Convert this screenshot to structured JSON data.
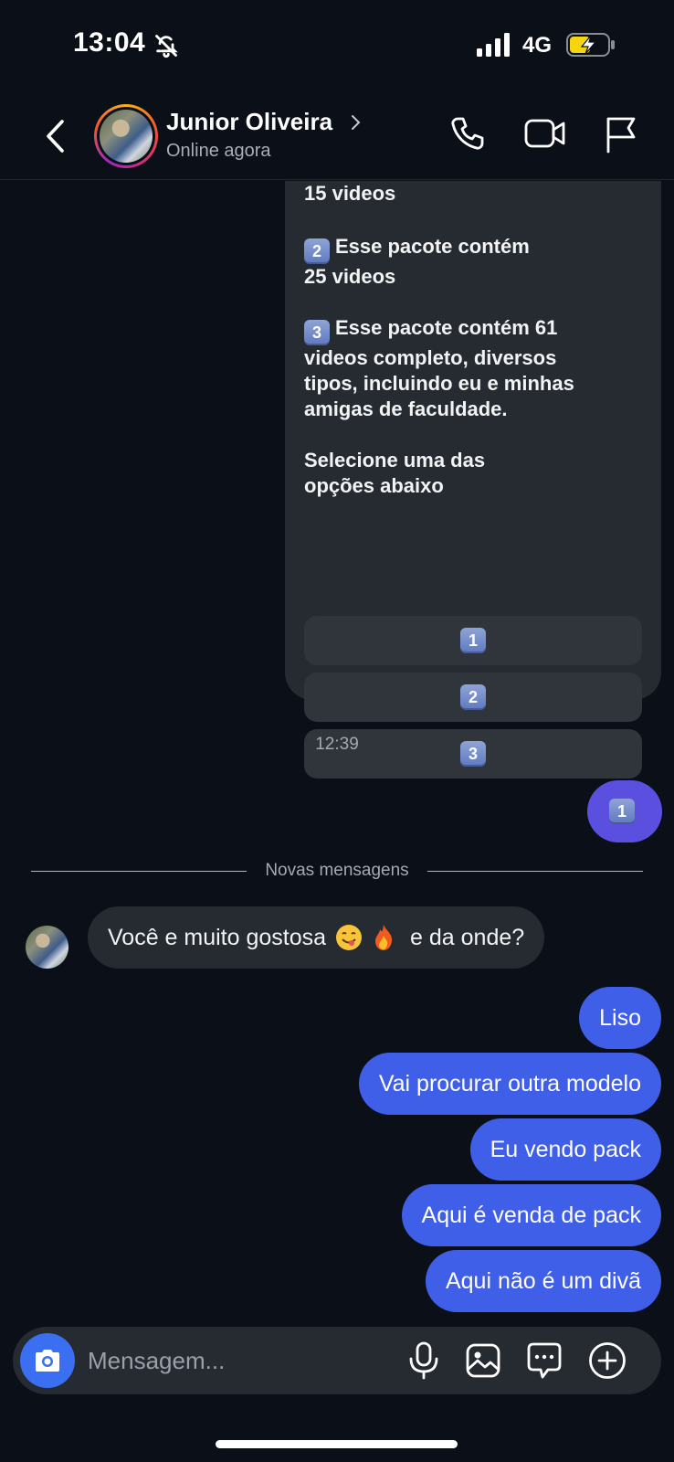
{
  "status_bar": {
    "time": "13:04",
    "network": "4G"
  },
  "header": {
    "name": "Junior Oliveira",
    "status": "Online agora"
  },
  "card": {
    "top_partial": "15 videos",
    "para2_lead": "2",
    "para2_text": "Esse pacote contém\n25 videos",
    "para3_lead": "3",
    "para3_text": "Esse pacote contém 61\nvideos completo, diversos\ntipos, incluindo eu e minhas\namigas de faculdade.",
    "para4_text": "Selecione uma das\nopções abaixo",
    "options": [
      "1",
      "2",
      "3"
    ]
  },
  "timestamp": "12:39",
  "sent_emoji": "1",
  "divider_label": "Novas mensagens",
  "incoming": {
    "text_a": "Você e muito gostosa",
    "text_b": "e da onde?"
  },
  "outgoing": [
    "Liso",
    "Vai procurar outra modelo",
    "Eu vendo pack",
    "Aqui é venda de pack",
    "Aqui não é um divã"
  ],
  "composer": {
    "placeholder": "Mensagem..."
  },
  "colors": {
    "bubble_out": "#3f5fe8",
    "bubble_in": "#262a31",
    "background": "#0b0f17",
    "accent": "#3a6ff1"
  }
}
